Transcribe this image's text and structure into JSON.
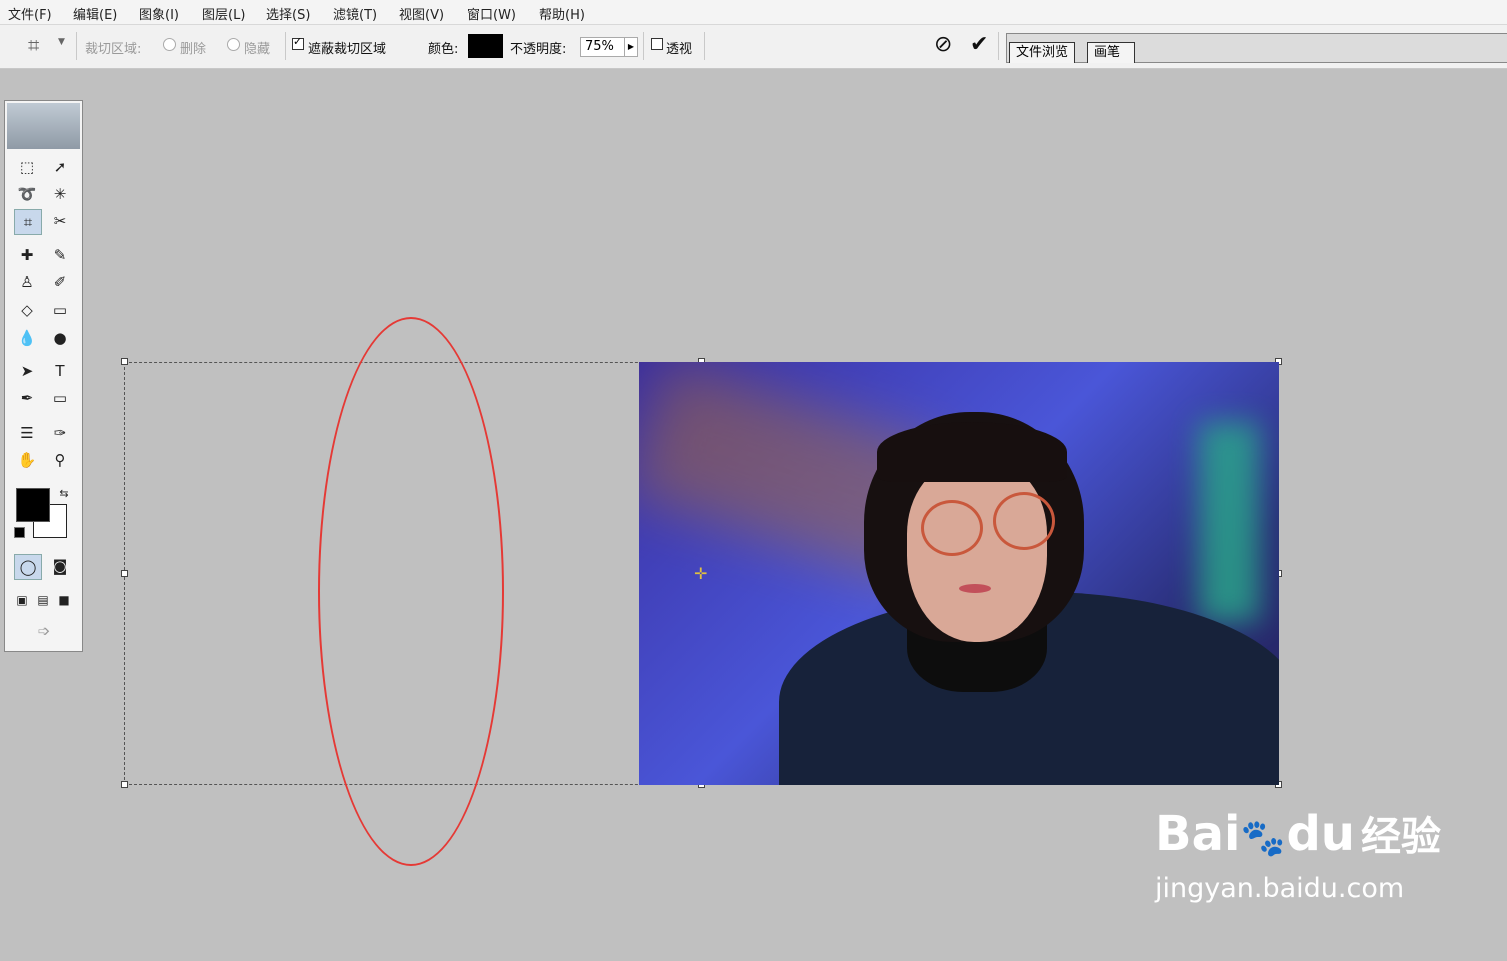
{
  "menu": [
    "文件(F)",
    "编辑(E)",
    "图象(I)",
    "图层(L)",
    "选择(S)",
    "滤镜(T)",
    "视图(V)",
    "窗口(W)",
    "帮助(H)"
  ],
  "options": {
    "crop_area_label": "裁切区域:",
    "delete_label": "删除",
    "hide_label": "隐藏",
    "shield_label": "遮蔽裁切区域",
    "color_label": "颜色:",
    "opacity_label": "不透明度:",
    "opacity_value": "75%",
    "perspective_label": "透视",
    "shield_checked": true,
    "perspective_checked": false,
    "shield_color": "#000000"
  },
  "well_tabs": [
    "文件浏览",
    "画笔"
  ],
  "annotation_color": "#e53935",
  "watermark": {
    "brand": "Bai",
    "brand2": "du",
    "product": "经验",
    "url": "jingyan.baidu.com"
  }
}
